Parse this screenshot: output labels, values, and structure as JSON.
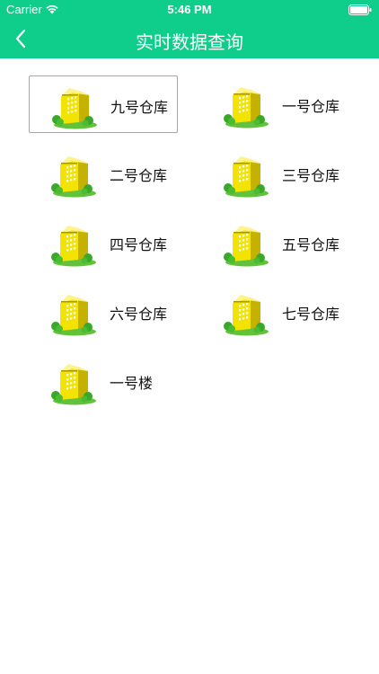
{
  "status_bar": {
    "carrier": "Carrier",
    "time": "5:46 PM",
    "wifi_icon": "wifi-icon",
    "battery_icon": "battery-icon"
  },
  "nav": {
    "title": "实时数据查询",
    "back_icon": "chevron-left-icon"
  },
  "colors": {
    "header_bg": "#0fce8b",
    "building_yellow": "#f2e400",
    "tree_green": "#3aa828"
  },
  "warehouses": [
    {
      "label": "九号仓库",
      "icon": "building-icon",
      "selected": true
    },
    {
      "label": "一号仓库",
      "icon": "building-icon",
      "selected": false
    },
    {
      "label": "二号仓库",
      "icon": "building-icon",
      "selected": false
    },
    {
      "label": "三号仓库",
      "icon": "building-icon",
      "selected": false
    },
    {
      "label": "四号仓库",
      "icon": "building-icon",
      "selected": false
    },
    {
      "label": "五号仓库",
      "icon": "building-icon",
      "selected": false
    },
    {
      "label": "六号仓库",
      "icon": "building-icon",
      "selected": false
    },
    {
      "label": "七号仓库",
      "icon": "building-icon",
      "selected": false
    },
    {
      "label": "一号楼",
      "icon": "building-icon",
      "selected": false
    }
  ]
}
